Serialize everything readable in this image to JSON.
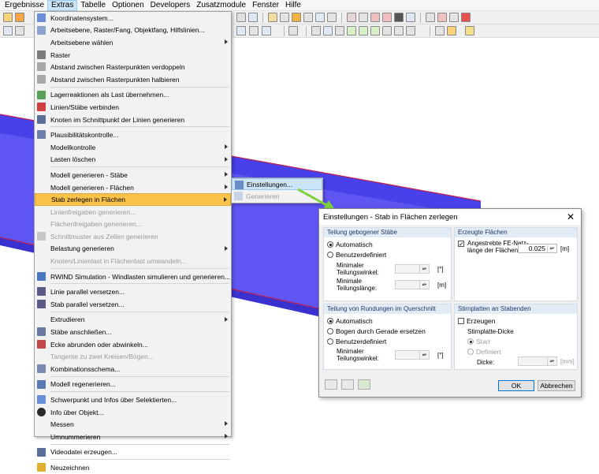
{
  "menubar": {
    "items": [
      "Ergebnisse",
      "Extras",
      "Tabelle",
      "Optionen",
      "Developers",
      "Zusatzmodule",
      "Fenster",
      "Hilfe"
    ]
  },
  "extras_menu": {
    "items": [
      {
        "label": "Koordinatensystem...",
        "icon": "coordinate-system-icon"
      },
      {
        "label": "Arbeitsebene, Raster/Fang, Objektfang, Hilfslinien...",
        "icon": "work-plane-icon"
      },
      {
        "label": "Arbeitsebene wählen",
        "icon": "",
        "submenu": true
      },
      {
        "label": "Raster",
        "icon": "grid-icon"
      },
      {
        "label": "Abstand zwischen Rasterpunkten verdoppeln",
        "icon": "grid-double-icon"
      },
      {
        "label": "Abstand zwischen Rasterpunkten halbieren",
        "icon": "grid-half-icon"
      },
      {
        "label": "Lagerreaktionen als Last übernehmen...",
        "icon": "support-reaction-icon"
      },
      {
        "label": "Linien/Stäbe verbinden",
        "icon": "connect-lines-icon"
      },
      {
        "label": "Knoten im Schnittpunkt der Linien generieren",
        "icon": "intersection-node-icon"
      },
      {
        "label": "Plausibilitätskontrolle...",
        "icon": "plausibility-check-icon"
      },
      {
        "label": "Modellkontrolle",
        "icon": "",
        "submenu": true
      },
      {
        "label": "Lasten löschen",
        "icon": "",
        "submenu": true
      },
      {
        "label": "Modell generieren - Stäbe",
        "icon": "",
        "submenu": true
      },
      {
        "label": "Modell generieren - Flächen",
        "icon": "",
        "submenu": true
      },
      {
        "label": "Stab zerlegen in Flächen",
        "icon": "",
        "submenu": true
      },
      {
        "label": "Linienfreigaben generieren...",
        "icon": ""
      },
      {
        "label": "Flächenfreigaben generieren...",
        "icon": ""
      },
      {
        "label": "Schnittmuster aus Zellen generieren",
        "icon": "cutting-pattern-icon"
      },
      {
        "label": "Belastung generieren",
        "icon": "",
        "submenu": true
      },
      {
        "label": "Knoten/Linienlast in Flächenlast umwandeln...",
        "icon": ""
      },
      {
        "label": "RWIND Simulation - Windlasten simulieren und generieren...",
        "icon": "rwind-icon"
      },
      {
        "label": "Linie parallel versetzen...",
        "icon": "parallel-line-icon"
      },
      {
        "label": "Stab parallel versetzen...",
        "icon": "parallel-member-icon"
      },
      {
        "label": "Extrudieren",
        "icon": "",
        "submenu": true
      },
      {
        "label": "Stäbe anschließen...",
        "icon": "connect-members-icon"
      },
      {
        "label": "Ecke abrunden oder abwinkeln...",
        "icon": "round-corner-icon"
      },
      {
        "label": "Tangente zu zwei Kreisen/Bögen...",
        "icon": ""
      },
      {
        "label": "Kombinationsschema...",
        "icon": "combination-scheme-icon"
      },
      {
        "label": "Modell regenerieren...",
        "icon": "regenerate-model-icon"
      },
      {
        "label": "Schwerpunkt und Infos über Selektierten...",
        "icon": "centroid-icon"
      },
      {
        "label": "Info über Objekt...",
        "icon": "info-icon"
      },
      {
        "label": "Messen",
        "icon": "",
        "submenu": true
      },
      {
        "label": "Umnummerieren",
        "icon": "",
        "submenu": true
      },
      {
        "label": "Videodatei erzeugen...",
        "icon": "video-icon"
      },
      {
        "label": "Neuzeichnen",
        "icon": "redraw-icon"
      }
    ]
  },
  "submenu": {
    "items": [
      {
        "label": "Einstellungen...",
        "icon": "settings-icon"
      },
      {
        "label": "Generieren",
        "icon": "generate-icon"
      }
    ]
  },
  "dialog": {
    "title": "Einstellungen - Stab in Flächen zerlegen",
    "close": "✕",
    "bent_members": {
      "header": "Teilung gebogener Stäbe",
      "auto": "Automatisch",
      "user": "Benutzerdefiniert",
      "min_angle_label_1": "Minimaler",
      "min_angle_label_2": "Teilungswinkel:",
      "min_angle_unit": "[°]",
      "min_length_label_1": "Minimale",
      "min_length_label_2": "Teilungslänge:",
      "min_length_unit": "[m]"
    },
    "generated_surfaces": {
      "header": "Erzeugte Flächen",
      "mesh_label_1": "Angestrebte FE-Netz-",
      "mesh_label_2": "länge der Flächen:",
      "mesh_value": "0.025",
      "mesh_unit": "[m]"
    },
    "roundings": {
      "header": "Teilung von Rundungen im Querschnitt",
      "auto": "Automatisch",
      "arc_straight": "Bogen durch Gerade ersetzen",
      "user": "Benutzerdefiniert",
      "min_angle_label_1": "Minimaler",
      "min_angle_label_2": "Teilungswinkel:",
      "min_angle_unit": "[°]"
    },
    "end_plates": {
      "header": "Stirnplatten an Stabenden",
      "create": "Erzeugen",
      "thickness": "Stirnplatte-Dicke",
      "rigid": "Starr",
      "defined": "Definiert",
      "thickness_label": "Dicke:",
      "thickness_unit": "[mm]"
    },
    "ok": "OK",
    "cancel": "Abbrechen"
  },
  "colors": {
    "highlight": "#f9c24a",
    "surface": "#5a4ff0",
    "arrow": "#7dd13c"
  }
}
